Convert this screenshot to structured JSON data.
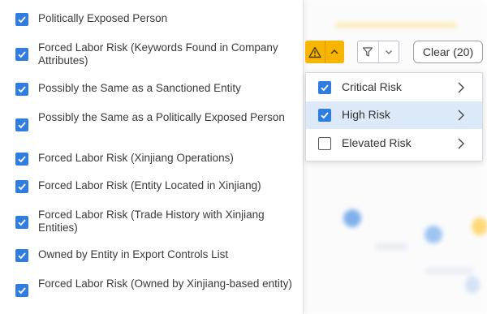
{
  "filter_options": [
    {
      "label": "Politically Exposed Person",
      "checked": true
    },
    {
      "label": "Forced Labor Risk (Keywords Found in Company Attributes)",
      "checked": true
    },
    {
      "label": "Possibly the Same as a Sanctioned Entity",
      "checked": true
    },
    {
      "label": "Possibly the Same as a Politically Exposed Person",
      "checked": true
    },
    {
      "label": "Forced Labor Risk (Xinjiang Operations)",
      "checked": true
    },
    {
      "label": "Forced Labor Risk (Entity Located in Xinjiang)",
      "checked": true
    },
    {
      "label": "Forced Labor Risk (Trade History with Xinjiang Entities)",
      "checked": true
    },
    {
      "label": "Owned by Entity in Export Controls List",
      "checked": true
    },
    {
      "label": "Forced Labor Risk (Owned by Xinjiang-based entity)",
      "checked": true
    }
  ],
  "toolbar": {
    "warning_icon": "warning-triangle-icon",
    "filter_icon": "funnel-icon",
    "clear_label": "Clear (20)",
    "colors": {
      "warning": "#f7b500",
      "accent": "#2f7de1"
    }
  },
  "risk_menu": {
    "items": [
      {
        "label": "Critical Risk",
        "checked": true,
        "highlighted": false
      },
      {
        "label": "High Risk",
        "checked": true,
        "highlighted": true
      },
      {
        "label": "Elevated Risk",
        "checked": false,
        "highlighted": false
      }
    ]
  }
}
